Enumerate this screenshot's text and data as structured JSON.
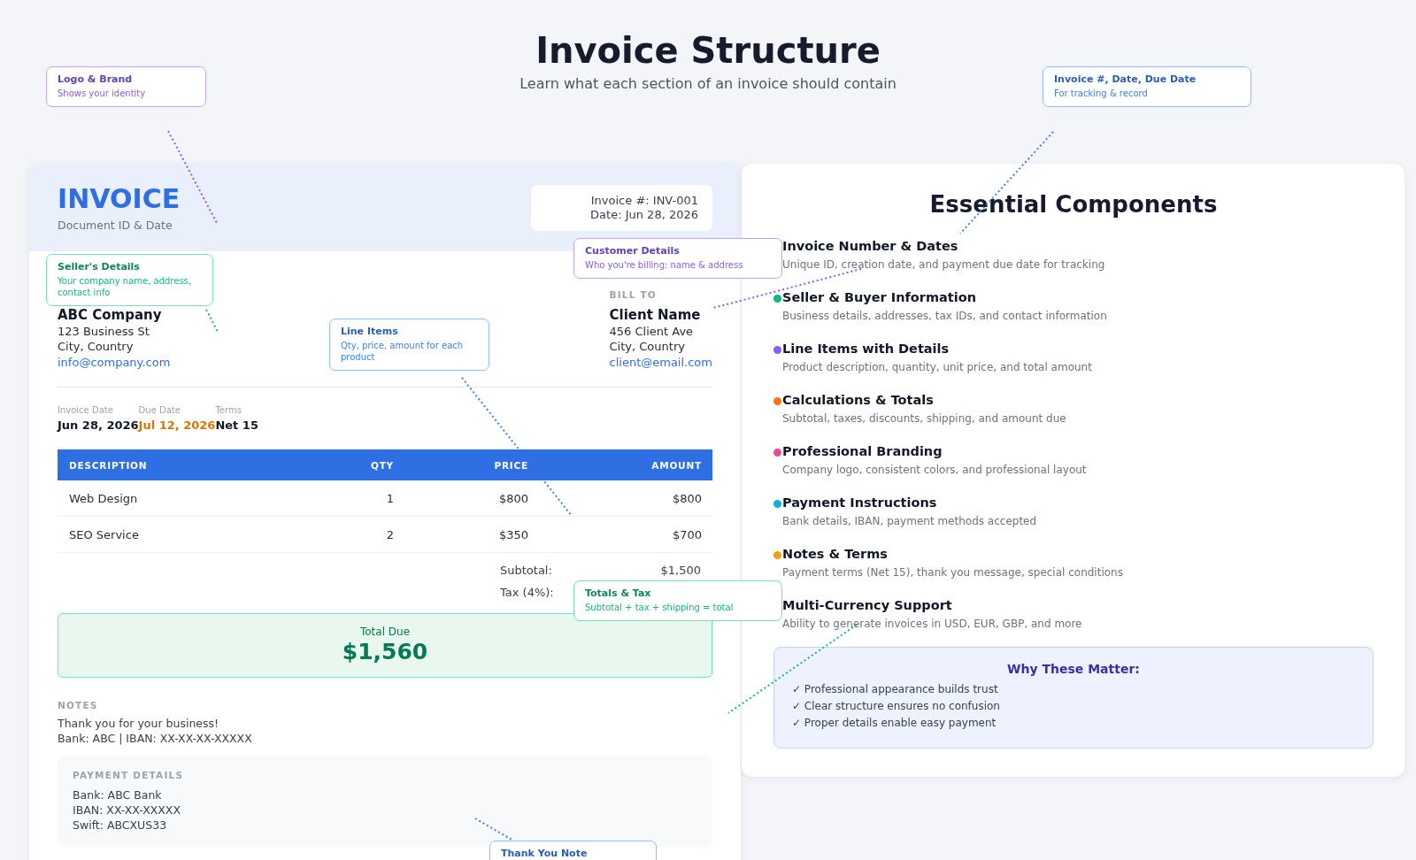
{
  "header": {
    "title": "Invoice Structure",
    "subtitle": "Learn what each section of an invoice should contain"
  },
  "invoice": {
    "title": "INVOICE",
    "caption": "Document ID & Date",
    "meta": [
      "Invoice #: INV-001",
      "Date: Jun 28, 2026"
    ],
    "seller": {
      "name": "ABC Company",
      "lines": [
        "123 Business St",
        "City, Country"
      ],
      "email": "info@company.com"
    },
    "bill_to": {
      "label": "BILL TO",
      "name": "Client Name",
      "lines": [
        "456 Client Ave",
        "City, Country"
      ],
      "email": "client@email.com"
    },
    "dates": [
      {
        "label": "Invoice Date",
        "value": "Jun 28, 2026",
        "kind": "normal"
      },
      {
        "label": "Due Date",
        "value": "Jul 12, 2026",
        "kind": "due"
      },
      {
        "label": "Terms",
        "value": "Net 15",
        "kind": "normal"
      }
    ],
    "table": {
      "columns": [
        "DESCRIPTION",
        "QTY",
        "PRICE",
        "AMOUNT"
      ],
      "rows": [
        [
          "Web Design",
          "1",
          "$800",
          "$800"
        ],
        [
          "SEO Service",
          "2",
          "$350",
          "$700"
        ]
      ]
    },
    "totals": [
      {
        "label": "Subtotal:",
        "value": "$1,500"
      },
      {
        "label": "Tax (4%):"
      }
    ],
    "total_due": {
      "label": "Total Due",
      "amount": "$1,560"
    },
    "notes": {
      "label": "NOTES",
      "lines": [
        "Thank you for your business!",
        "Bank: ABC | IBAN: XX-XX-XX-XXXXX"
      ]
    },
    "payment_details": {
      "label": "PAYMENT DETAILS",
      "lines": [
        "Bank: ABC Bank",
        "IBAN: XX-XX-XXXXX",
        "Swift: ABCXUS33"
      ]
    }
  },
  "components": {
    "title": "Essential Components",
    "items": [
      {
        "title": "Invoice Number & Dates",
        "description": "Unique ID, creation date, and payment due date for tracking"
      },
      {
        "title": "Seller & Buyer Information",
        "description": "Business details, addresses, tax IDs, and contact information",
        "color": "#10b981"
      },
      {
        "title": "Line Items with Details",
        "description": "Product description, quantity, unit price, and total amount",
        "color": "#8b5cf6"
      },
      {
        "title": "Calculations & Totals",
        "description": "Subtotal, taxes, discounts, shipping, and amount due",
        "color": "#f97316"
      },
      {
        "title": "Professional Branding",
        "description": "Company logo, consistent colors, and professional layout",
        "color": "#ec4899"
      },
      {
        "title": "Payment Instructions",
        "description": "Bank details, IBAN, payment methods accepted",
        "color": "#06b6d4"
      },
      {
        "title": "Notes & Terms",
        "description": "Payment terms (Net 15), thank you message, special conditions",
        "color": "#f59e0b"
      },
      {
        "title": "Multi-Currency Support",
        "description": "Ability to generate invoices in USD, EUR, GBP, and more"
      }
    ]
  },
  "why": {
    "title": "Why These Matter:",
    "items": [
      "✓ Professional appearance builds trust",
      "✓ Clear structure ensures no confusion",
      "✓ Proper details enable easy payment"
    ]
  },
  "callouts": [
    {
      "title": "Logo & Brand",
      "subtitle": "Shows your identity",
      "color": "#8b5cf6"
    },
    {
      "title": "Invoice #, Date, Due Date",
      "subtitle": "For tracking & record",
      "color": "#3b82f6"
    },
    {
      "title": "Customer Details",
      "subtitle": "Who you're billing: name & address",
      "color": "#8b5cf6"
    },
    {
      "title": "Seller's Details",
      "subtitle": "Your company name, address, contact info",
      "color": "#10b981"
    },
    {
      "title": "Line Items",
      "subtitle": "Qty, price, amount for each product",
      "color": "#3b82f6"
    },
    {
      "title": "Totals & Tax",
      "subtitle": "Subtotal + tax + shipping = total",
      "color": "#10b981"
    },
    {
      "title": "Thank You Note",
      "color": "#3b82f6"
    }
  ]
}
